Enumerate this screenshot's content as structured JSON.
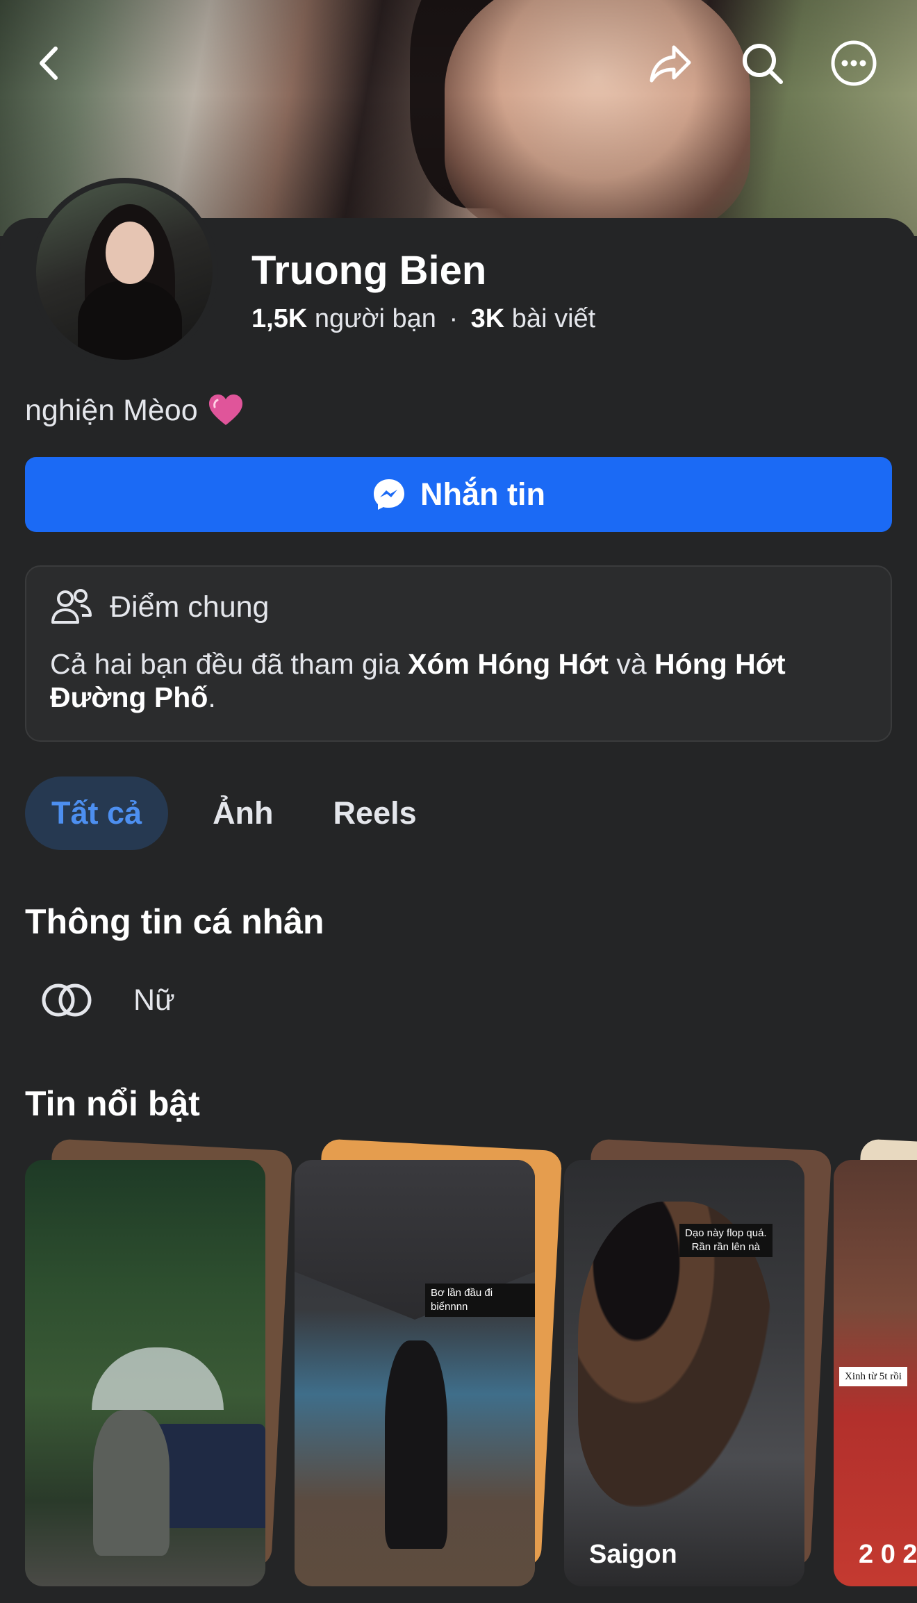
{
  "cover": {
    "back_icon": "chevron-left-icon",
    "share_icon": "share-arrow-icon",
    "search_icon": "search-icon",
    "more_icon": "more-dots-icon"
  },
  "profile": {
    "name": "Truong Bien",
    "friends_count": "1,5K",
    "friends_label": "người bạn",
    "separator": "·",
    "posts_count": "3K",
    "posts_label": "bài viết",
    "bio": "nghiện Mèoo"
  },
  "actions": {
    "message_label": "Nhắn tin",
    "accent_color": "#1b6af5"
  },
  "mutual": {
    "title": "Điểm chung",
    "text_prefix": "Cả hai bạn đều đã tham gia ",
    "group1": "Xóm Hóng Hớt",
    "text_mid": " và ",
    "group2": "Hóng Hớt Đường Phố",
    "text_suffix": "."
  },
  "tabs": [
    {
      "label": "Tất cả",
      "active": true
    },
    {
      "label": "Ảnh",
      "active": false
    },
    {
      "label": "Reels",
      "active": false
    }
  ],
  "personal_info": {
    "title": "Thông tin cá nhân",
    "gender": "Nữ"
  },
  "highlights": {
    "title": "Tin nổi bật",
    "items": [
      {
        "label": "",
        "caption": ""
      },
      {
        "label": "",
        "caption": "Bơ lần đầu đi biểnnnn"
      },
      {
        "label": "Saigon",
        "caption": "Dạo này flop quá.\nRần rần lên nà"
      },
      {
        "label": "2 0 2",
        "caption": "Xinh từ 5t rồi"
      }
    ]
  }
}
